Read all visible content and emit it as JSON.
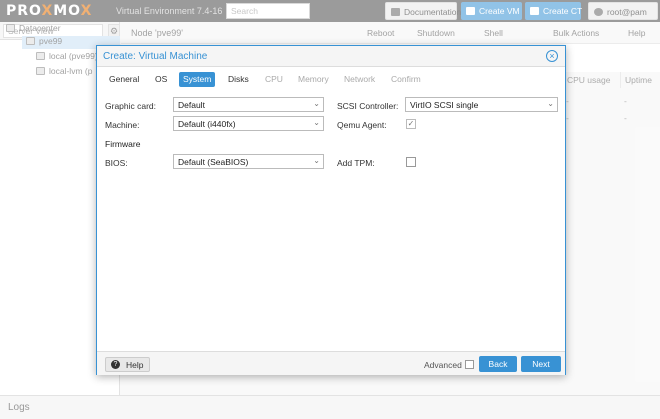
{
  "header": {
    "logo_pre": "PRO",
    "logo_x": "X",
    "logo_post": "MO",
    "logo_x2": "X",
    "version": "Virtual Environment 7.4-16",
    "search_placeholder": "Search",
    "documentation": "Documentation",
    "create_vm": "Create VM",
    "create_ct": "Create CT",
    "user": "root@pam"
  },
  "tree": {
    "view": "Server View",
    "datacenter": "Datacenter",
    "node": "pve99",
    "local": "local (pve99)",
    "local_lvm": "local-lvm (p"
  },
  "content": {
    "node_title": "Node 'pve99'",
    "reboot": "Reboot",
    "shutdown": "Shutdown",
    "shell": "Shell",
    "bulk_actions": "Bulk Actions",
    "help": "Help",
    "col_cpu": "CPU usage",
    "col_uptime": "Uptime",
    "dash": "-"
  },
  "logs": {
    "label": "Logs"
  },
  "dialog": {
    "title": "Create: Virtual Machine",
    "tabs": [
      "General",
      "OS",
      "System",
      "Disks",
      "CPU",
      "Memory",
      "Network",
      "Confirm"
    ],
    "active_tab": "System",
    "fields": {
      "graphic_card_label": "Graphic card:",
      "graphic_card_value": "Default",
      "machine_label": "Machine:",
      "machine_value": "Default (i440fx)",
      "firmware_section": "Firmware",
      "bios_label": "BIOS:",
      "bios_value": "Default (SeaBIOS)",
      "scsi_label": "SCSI Controller:",
      "scsi_value": "VirtIO SCSI single",
      "qemu_agent_label": "Qemu Agent:",
      "add_tpm_label": "Add TPM:"
    },
    "footer": {
      "help": "Help",
      "advanced": "Advanced",
      "back": "Back",
      "next": "Next"
    }
  }
}
